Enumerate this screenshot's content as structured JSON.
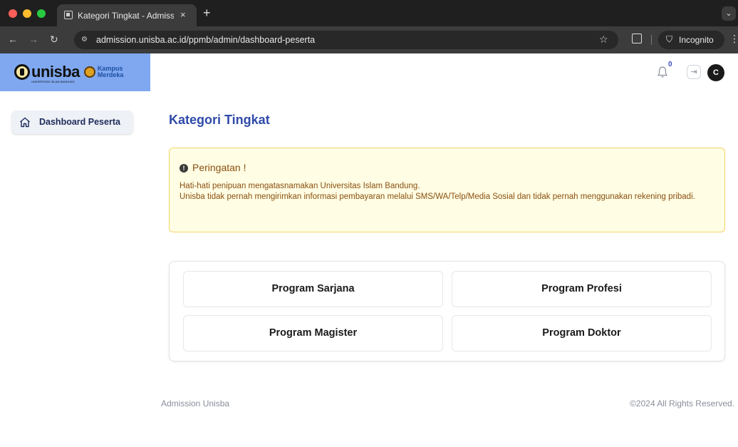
{
  "browser": {
    "tab_title": "Kategori Tingkat - Admission",
    "tab_close": "×",
    "new_tab": "+",
    "url": "admission.unisba.ac.id/ppmb/admin/dashboard-peserta",
    "incognito_label": "Incognito"
  },
  "header": {
    "logo_word": "unisba",
    "logo_sub": "UNIVERSITAS ISLAM BANDUNG",
    "kampus_line1": "Kampus",
    "kampus_line2": "Merdeka",
    "notification_count": "0",
    "avatar_letter": "C"
  },
  "sidebar": {
    "items": [
      {
        "label": "Dashboard Peserta"
      }
    ]
  },
  "main": {
    "title": "Kategori Tingkat",
    "alert": {
      "title": "Peringatan !",
      "line1": "Hati-hati penipuan mengatasnamakan Universitas Islam Bandung.",
      "line2": "Unisba tidak pernah mengirimkan informasi pembayaran melalui SMS/WA/Telp/Media Sosial dan tidak pernah menggunakan rekening pribadi."
    },
    "programs": [
      {
        "label": "Program Sarjana"
      },
      {
        "label": "Program Profesi"
      },
      {
        "label": "Program Magister"
      },
      {
        "label": "Program Doktor"
      }
    ]
  },
  "footer": {
    "left": "Admission Unisba",
    "right": "©2024 All Rights Reserved."
  },
  "colors": {
    "accent": "#2f4aa8",
    "logo_bg": "#7fa8f0",
    "alert_bg": "#fffde3",
    "alert_text": "#8a4f10"
  }
}
